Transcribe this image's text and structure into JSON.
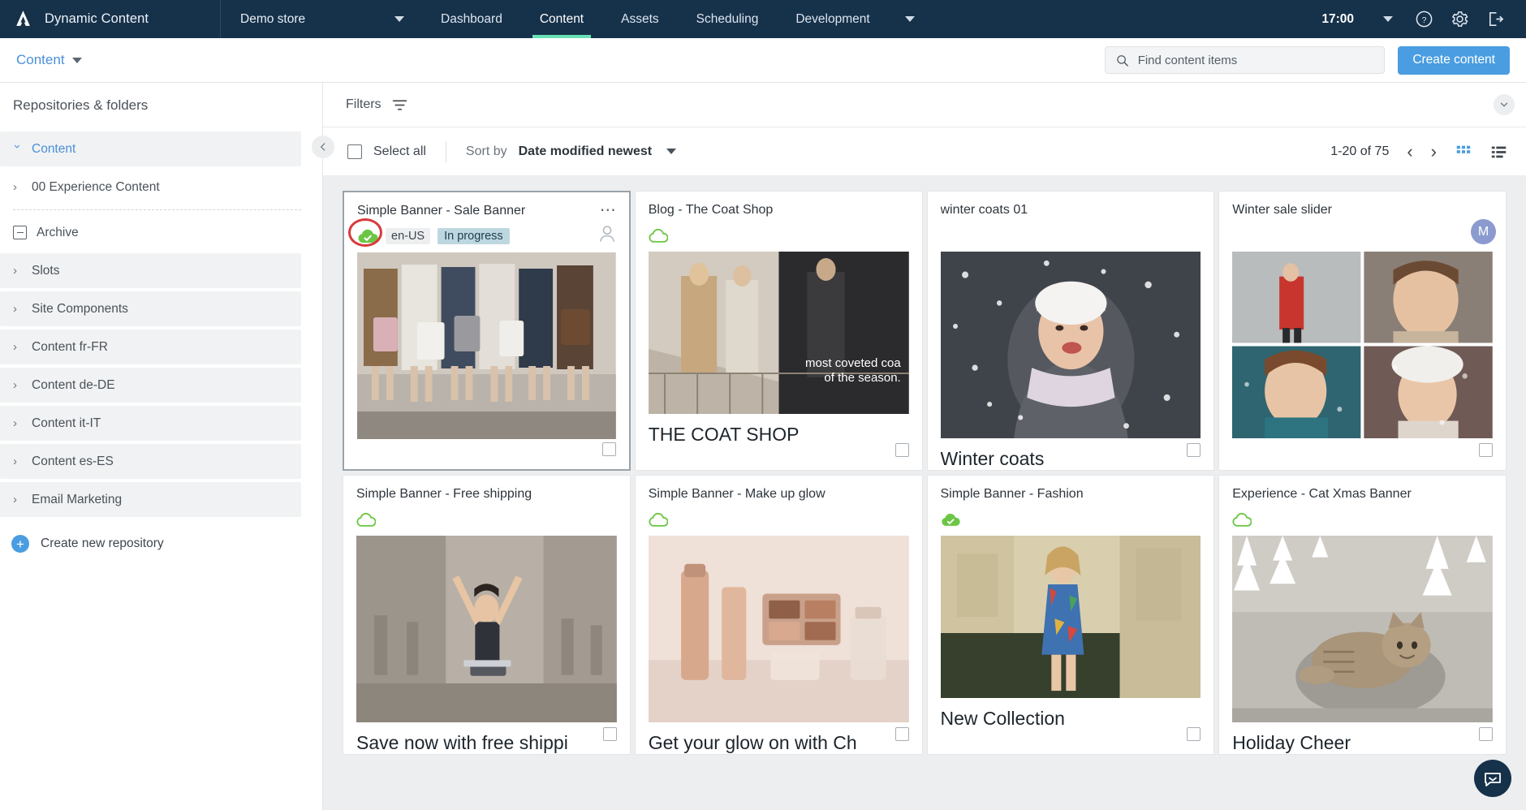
{
  "topnav": {
    "brand": "Dynamic Content",
    "store": "Demo store",
    "tabs": [
      {
        "label": "Dashboard",
        "active": false
      },
      {
        "label": "Content",
        "active": true
      },
      {
        "label": "Assets",
        "active": false
      },
      {
        "label": "Scheduling",
        "active": false
      },
      {
        "label": "Development",
        "active": false
      }
    ],
    "time": "17:00",
    "icons": [
      "help-icon",
      "gear-icon",
      "logout-icon"
    ]
  },
  "subheader": {
    "breadcrumb": "Content",
    "search_placeholder": "Find content items",
    "search_value": "",
    "create_button": "Create content"
  },
  "sidebar": {
    "title": "Repositories & folders",
    "items": [
      {
        "label": "Content",
        "icon": "chevron-down-icon",
        "selected": true,
        "indent": 0
      },
      {
        "label": "00 Experience Content",
        "icon": "chevron-right-icon",
        "selected": false,
        "indent": 1,
        "plain": true
      },
      {
        "label": "Archive",
        "icon": "archive-icon",
        "selected": false,
        "indent": 1,
        "plain": true
      },
      {
        "label": "Slots",
        "icon": "chevron-right-icon",
        "selected": false,
        "indent": 1
      },
      {
        "label": "Site Components",
        "icon": "chevron-right-icon",
        "selected": false,
        "indent": 1
      },
      {
        "label": "Content fr-FR",
        "icon": "chevron-right-icon",
        "selected": false,
        "indent": 1
      },
      {
        "label": "Content de-DE",
        "icon": "chevron-right-icon",
        "selected": false,
        "indent": 1
      },
      {
        "label": "Content it-IT",
        "icon": "chevron-right-icon",
        "selected": false,
        "indent": 1
      },
      {
        "label": "Content es-ES",
        "icon": "chevron-right-icon",
        "selected": false,
        "indent": 1
      },
      {
        "label": "Email Marketing",
        "icon": "chevron-right-icon",
        "selected": false,
        "indent": 1
      }
    ],
    "create_repository": "Create new repository"
  },
  "toolbar": {
    "filters_label": "Filters",
    "select_all_label": "Select all",
    "select_all_checked": false,
    "sort_by_label": "Sort by",
    "sort_value": "Date modified newest",
    "page_count": "1-20 of 75",
    "prev_label": "‹",
    "next_label": "›",
    "grid_view": "grid-view-icon",
    "list_view": "list-view-icon"
  },
  "cards": [
    {
      "title": "Simple Banner - Sale Banner",
      "locale": "en-US",
      "status": "In progress",
      "cloud": "published",
      "annotated": true,
      "selected": true,
      "kebab": true,
      "avatar": "outline",
      "avatar_letter": "",
      "caption": "",
      "thumb": "shoppers-with-bags"
    },
    {
      "title": "Blog - The Coat Shop",
      "locale": "",
      "status": "",
      "cloud": "published",
      "annotated": false,
      "selected": false,
      "kebab": false,
      "avatar": "",
      "avatar_letter": "",
      "caption": "THE COAT SHOP",
      "thumb": "coat-shop-banner"
    },
    {
      "title": "winter coats 01",
      "locale": "",
      "status": "",
      "cloud": "",
      "annotated": false,
      "selected": false,
      "kebab": false,
      "avatar": "",
      "avatar_letter": "",
      "caption": "Winter coats",
      "thumb": "winter-woman-snow"
    },
    {
      "title": "Winter sale slider",
      "locale": "",
      "status": "",
      "cloud": "",
      "annotated": false,
      "selected": false,
      "kebab": false,
      "avatar": "letter",
      "avatar_letter": "M",
      "caption": "",
      "thumb": "winter-collage-4up"
    },
    {
      "title": "Simple Banner - Free shipping",
      "locale": "",
      "status": "",
      "cloud": "published",
      "annotated": false,
      "selected": false,
      "kebab": false,
      "avatar": "",
      "avatar_letter": "",
      "caption": "Save now with free shippi",
      "thumb": "woman-laptop-street"
    },
    {
      "title": "Simple Banner - Make up glow",
      "locale": "",
      "status": "",
      "cloud": "published",
      "annotated": false,
      "selected": false,
      "kebab": false,
      "avatar": "",
      "avatar_letter": "",
      "caption": "Get your glow on with Ch",
      "thumb": "makeup-palettes"
    },
    {
      "title": "Simple Banner - Fashion",
      "locale": "",
      "status": "",
      "cloud": "published-check",
      "annotated": false,
      "selected": false,
      "kebab": false,
      "avatar": "",
      "avatar_letter": "",
      "caption": "New Collection",
      "thumb": "woman-floral-dress"
    },
    {
      "title": "Experience - Cat Xmas Banner",
      "locale": "",
      "status": "",
      "cloud": "published",
      "annotated": false,
      "selected": false,
      "kebab": false,
      "avatar": "",
      "avatar_letter": "",
      "caption": "Holiday Cheer",
      "thumb": "cat-christmas-tree"
    }
  ],
  "colors": {
    "nav_bg": "#16314a",
    "accent_green": "#68e1b4",
    "link_blue": "#4a90d9",
    "primary_button": "#4a9de0",
    "cloud_green": "#6cc644",
    "annotation_red": "#d9393c",
    "status_badge": "#bdd7e0"
  }
}
